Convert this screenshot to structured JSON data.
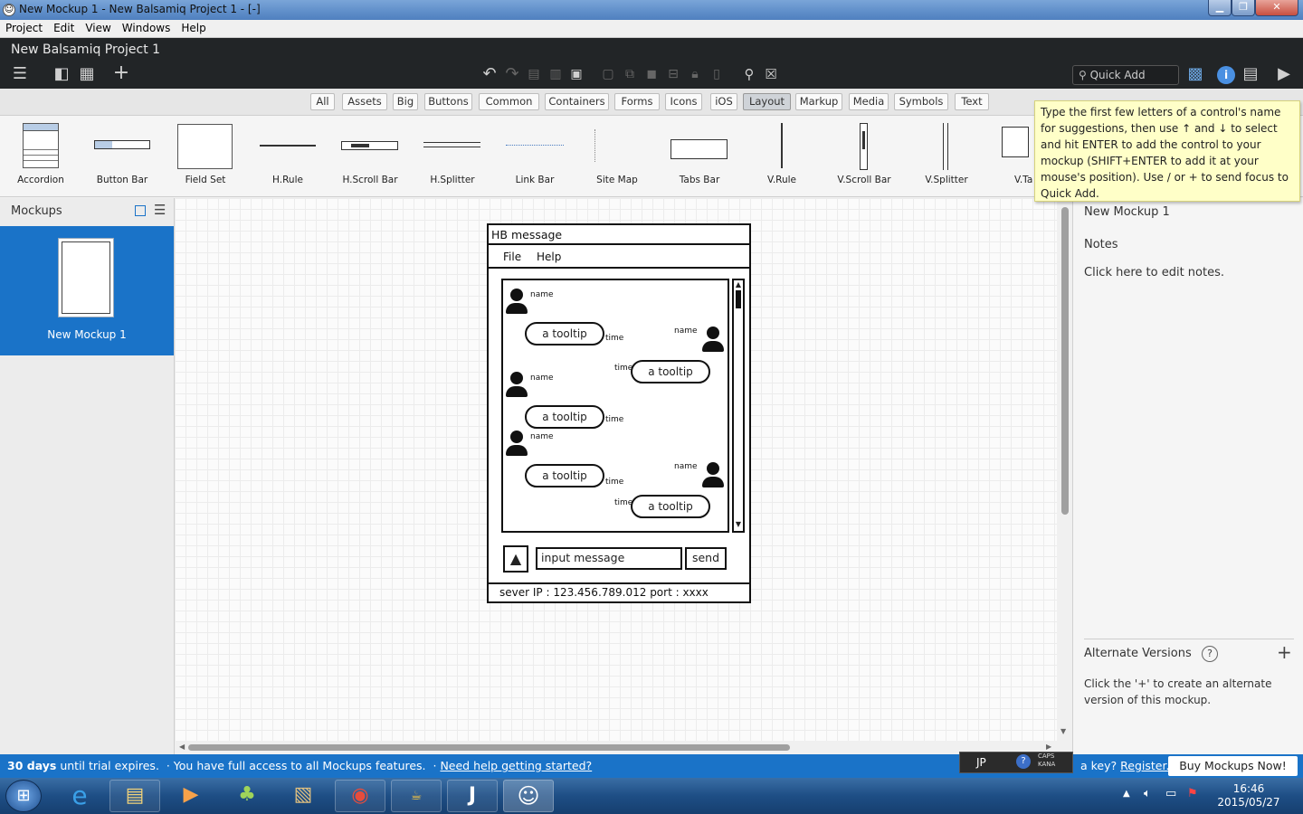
{
  "window": {
    "title": "New Mockup 1 - New Balsamiq Project 1 - [-]"
  },
  "menubar": [
    "Project",
    "Edit",
    "View",
    "Windows",
    "Help"
  ],
  "app": {
    "project_title": "New Balsamiq Project 1",
    "quick_add_placeholder": "Quick Add"
  },
  "filters": [
    "All",
    "Assets",
    "Big",
    "Buttons",
    "Common",
    "Containers",
    "Forms",
    "Icons",
    "iOS",
    "Layout",
    "Markup",
    "Media",
    "Symbols",
    "Text"
  ],
  "selected_filter": "Layout",
  "library": [
    "Accordion",
    "Button Bar",
    "Field Set",
    "H.Rule",
    "H.Scroll Bar",
    "H.Splitter",
    "Link Bar",
    "Site Map",
    "Tabs Bar",
    "V.Rule",
    "V.Scroll Bar",
    "V.Splitter",
    "V.Ta"
  ],
  "tooltip": "Type the first few letters of a control's name for suggestions, then use ↑ and ↓ to select and hit ENTER to add the control to your mockup (SHIFT+ENTER to add it at your mouse's position). Use / or + to send focus to Quick Add.",
  "left_panel": {
    "title": "Mockups",
    "item_label": "New Mockup 1"
  },
  "right_panel": {
    "mockup_name": "New Mockup 1",
    "notes_label": "Notes",
    "notes_placeholder": "Click here to edit notes.",
    "alt_title": "Alternate Versions",
    "alt_help": "?",
    "alt_desc": "Click the '+' to create an alternate version of this mockup."
  },
  "mockup": {
    "title": "HB message",
    "menu": [
      "File",
      "Help"
    ],
    "name": "name",
    "time": "time",
    "tooltip": "a tooltip",
    "input": "input message",
    "send": "send",
    "status": "sever IP : 123.456.789.012 port : xxxx"
  },
  "trial": {
    "days": "30 days",
    "text1": " until trial expires.  · You have full access to all Mockups features.  · ",
    "help_link": "Need help getting started?",
    "ime": "JP",
    "caps": "CAPS",
    "kana": "KANA",
    "key_text": "a key?",
    "register": "Register...",
    "buy": "Buy Mockups Now!"
  },
  "taskbar": {
    "time": "16:46",
    "date": "2015/05/27"
  },
  "colors": {
    "accent": "#1a73c8",
    "header": "#222527",
    "tooltip": "#ffffc8"
  }
}
